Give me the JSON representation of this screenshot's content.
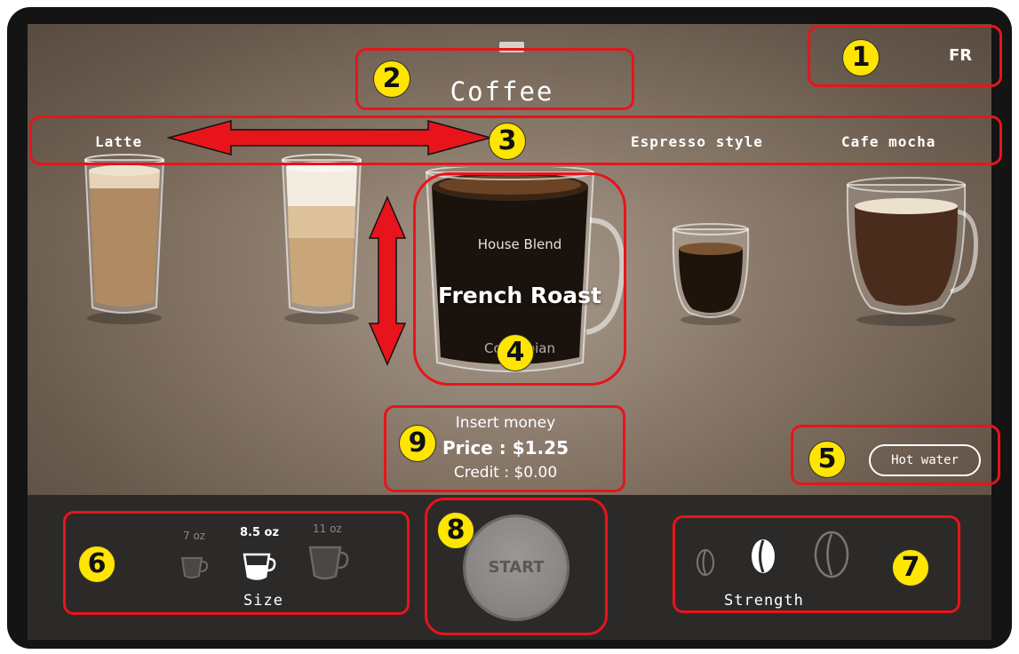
{
  "header": {
    "language": "FR",
    "title": "Coffee"
  },
  "categories": [
    "Latte",
    "Espresso style",
    "Cafe mocha"
  ],
  "blends": {
    "above": "House Blend",
    "selected": "French Roast",
    "below": "Colombian"
  },
  "payment": {
    "prompt": "Insert money",
    "price": "Price : $1.25",
    "credit": "Credit : $0.00"
  },
  "hot_water_label": "Hot water",
  "size": {
    "label": "Size",
    "options": [
      {
        "label": "7 oz",
        "selected": false
      },
      {
        "label": "8.5 oz",
        "selected": true
      },
      {
        "label": "11 oz",
        "selected": false
      }
    ]
  },
  "start_label": "START",
  "strength": {
    "label": "Strength",
    "selected_level": 2,
    "levels": 3
  },
  "annotations": [
    "1",
    "2",
    "3",
    "4",
    "5",
    "6",
    "7",
    "8",
    "9"
  ],
  "colors": {
    "annotation_box": "#e8141b",
    "annotation_badge": "#ffe500",
    "bottom_bar": "#2c2a28"
  }
}
